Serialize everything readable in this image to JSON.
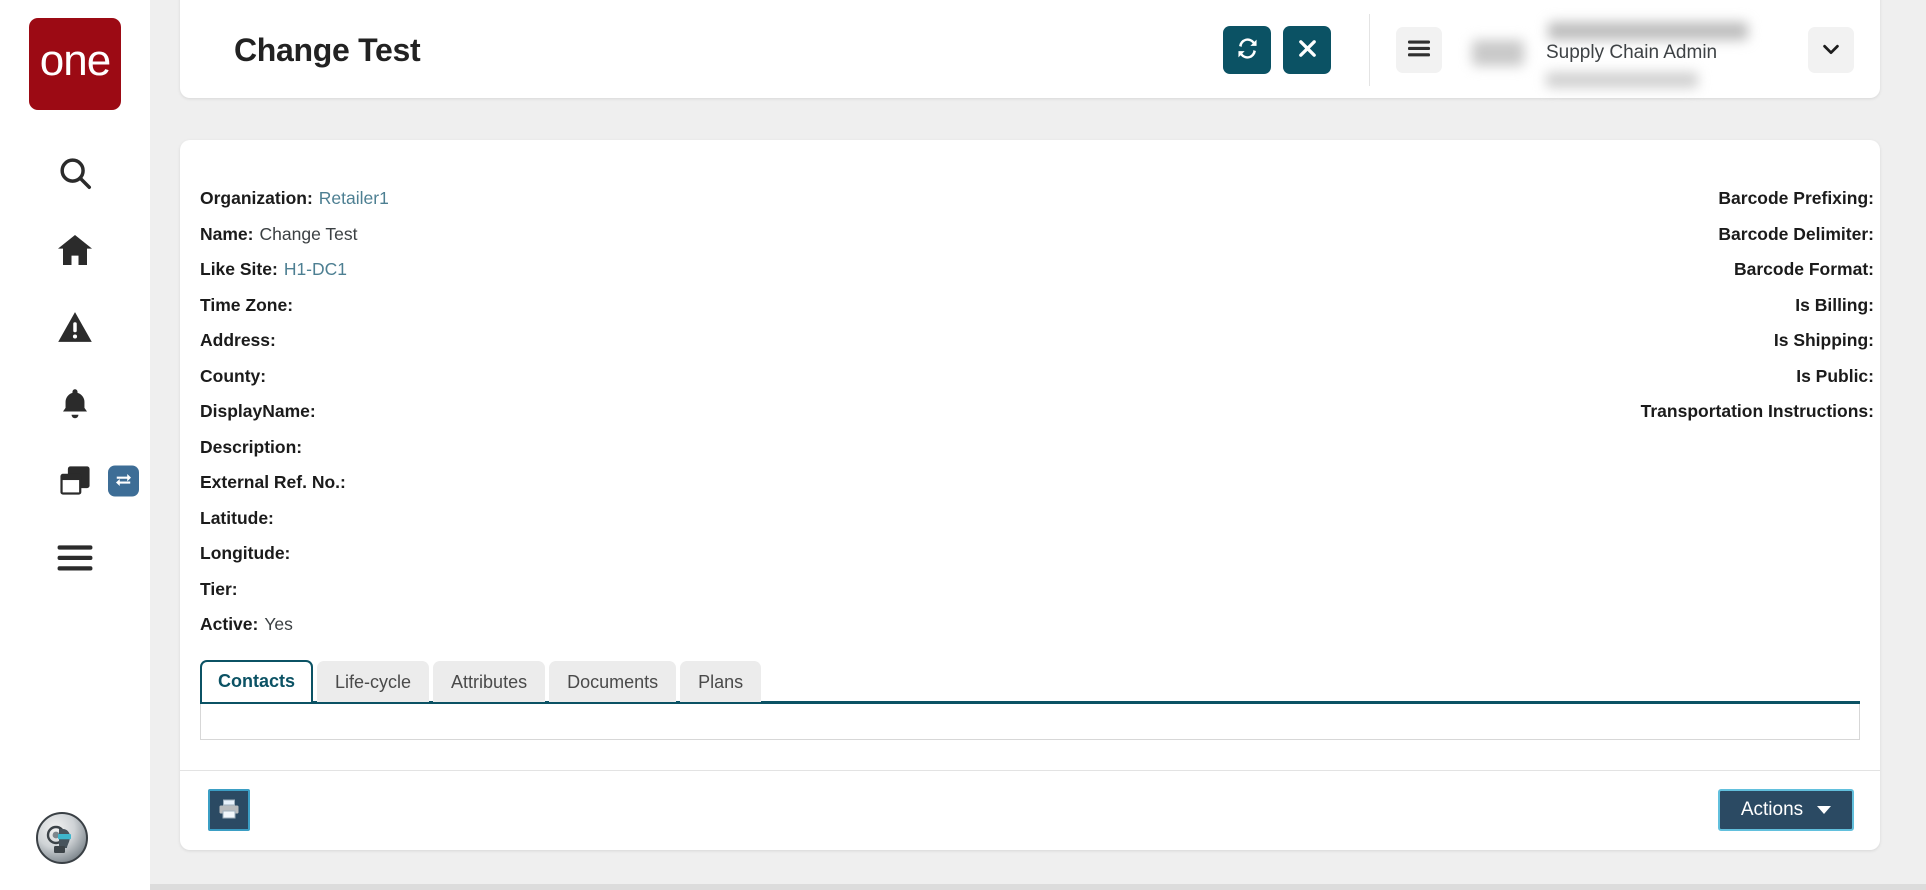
{
  "sidebar": {
    "logo_text": "one",
    "items": [
      {
        "name": "search",
        "icon": "search-icon"
      },
      {
        "name": "home",
        "icon": "home-icon"
      },
      {
        "name": "alerts",
        "icon": "warning-triangle-icon"
      },
      {
        "name": "notifications",
        "icon": "bell-icon"
      },
      {
        "name": "windows",
        "icon": "windows-stack-icon"
      },
      {
        "name": "menu",
        "icon": "hamburger-menu-icon"
      }
    ],
    "toggle_badge_icon": "swap-arrows-icon",
    "assistant_avatar_icon": "robot-assistant-avatar"
  },
  "header": {
    "title": "Change Test",
    "refresh_icon": "refresh-icon",
    "close_icon": "close-x-icon",
    "menu_icon": "hamburger-menu-icon",
    "user_role": "Supply Chain Admin",
    "dropdown_icon": "chevron-down-icon"
  },
  "details": {
    "left": [
      {
        "label": "Organization:",
        "value": "Retailer1",
        "link": true
      },
      {
        "label": "Name:",
        "value": "Change Test",
        "link": false
      },
      {
        "label": "Like Site:",
        "value": "H1-DC1",
        "link": true
      },
      {
        "label": "Time Zone:",
        "value": "",
        "link": false
      },
      {
        "label": "Address:",
        "value": "",
        "link": false
      },
      {
        "label": "County:",
        "value": "",
        "link": false
      },
      {
        "label": "DisplayName:",
        "value": "",
        "link": false
      },
      {
        "label": "Description:",
        "value": "",
        "link": false
      },
      {
        "label": "External Ref. No.:",
        "value": "",
        "link": false
      },
      {
        "label": "Latitude:",
        "value": "",
        "link": false
      },
      {
        "label": "Longitude:",
        "value": "",
        "link": false
      },
      {
        "label": "Tier:",
        "value": "",
        "link": false
      },
      {
        "label": "Active:",
        "value": "Yes",
        "link": false
      }
    ],
    "right": [
      {
        "label": "Barcode Prefixing:",
        "value": ""
      },
      {
        "label": "Barcode Delimiter:",
        "value": ""
      },
      {
        "label": "Barcode Format:",
        "value": ""
      },
      {
        "label": "Is Billing:",
        "value": ""
      },
      {
        "label": "Is Shipping:",
        "value": ""
      },
      {
        "label": "Is Public:",
        "value": ""
      },
      {
        "label": "Transportation Instructions:",
        "value": ""
      }
    ]
  },
  "tabs": [
    {
      "label": "Contacts",
      "active": true
    },
    {
      "label": "Life-cycle",
      "active": false
    },
    {
      "label": "Attributes",
      "active": false
    },
    {
      "label": "Documents",
      "active": false
    },
    {
      "label": "Plans",
      "active": false
    }
  ],
  "footer": {
    "print_icon": "printer-icon",
    "actions_label": "Actions",
    "actions_caret_icon": "caret-down-icon"
  },
  "colors": {
    "brand_red": "#9c0a14",
    "teal": "#0b5264",
    "navy": "#2b4a63",
    "link": "#4d7f92",
    "page_bg": "#efefef"
  }
}
